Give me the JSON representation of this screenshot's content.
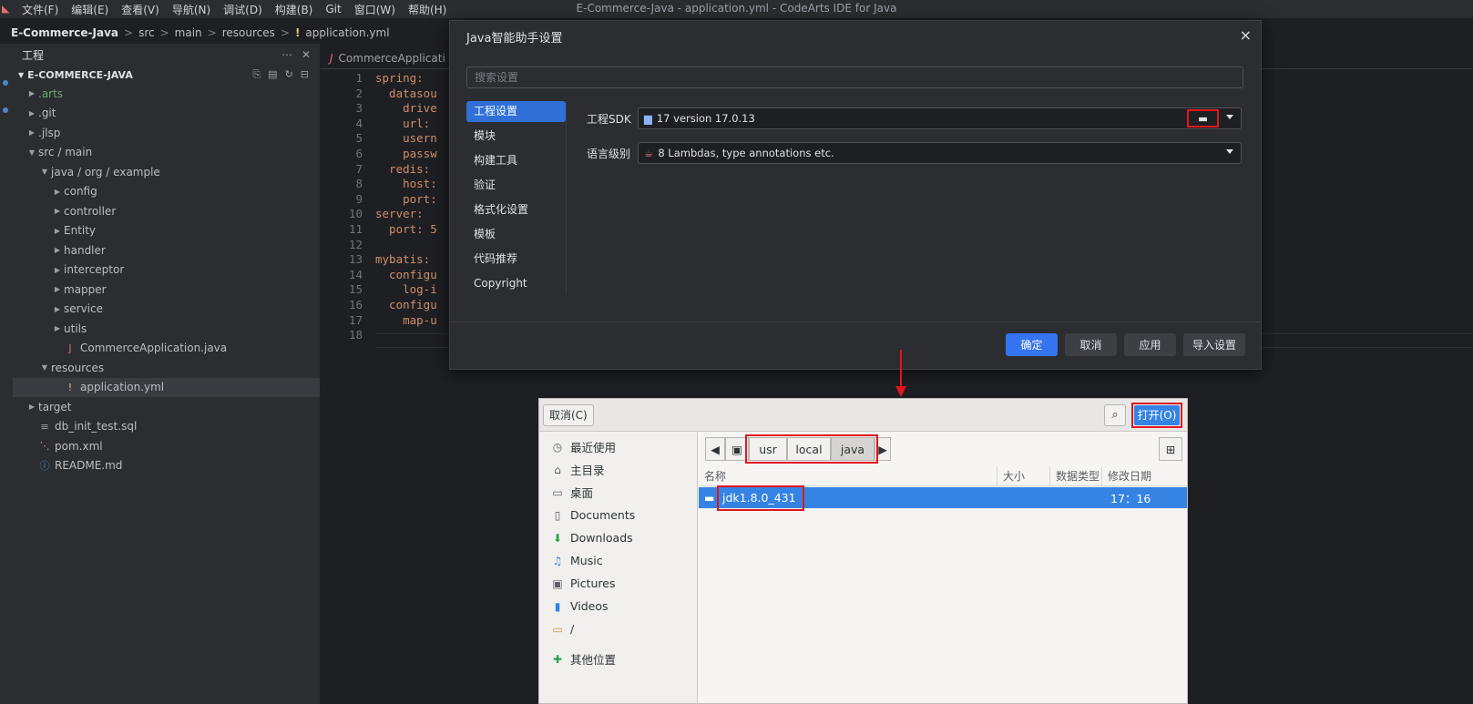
{
  "menubar": {
    "items": [
      "文件(F)",
      "编辑(E)",
      "查看(V)",
      "导航(N)",
      "调试(D)",
      "构建(B)",
      "Git",
      "窗口(W)",
      "帮助(H)"
    ],
    "window_title": "E-Commerce-Java - application.yml - CodeArts IDE for Java"
  },
  "breadcrumb": {
    "project": "E-Commerce-Java",
    "parts": [
      "src",
      "main",
      "resources",
      "application.yml"
    ]
  },
  "sidebar": {
    "title": "工程",
    "root": "E-COMMERCE-JAVA",
    "tree": [
      {
        "label": ".arts",
        "depth": 1,
        "type": "folder",
        "green": true
      },
      {
        "label": ".git",
        "depth": 1,
        "type": "folder"
      },
      {
        "label": ".jlsp",
        "depth": 1,
        "type": "folder"
      },
      {
        "label": "src / main",
        "depth": 1,
        "type": "folder-open"
      },
      {
        "label": "java / org / example",
        "depth": 2,
        "type": "folder-open"
      },
      {
        "label": "config",
        "depth": 3,
        "type": "folder"
      },
      {
        "label": "controller",
        "depth": 3,
        "type": "folder"
      },
      {
        "label": "Entity",
        "depth": 3,
        "type": "folder"
      },
      {
        "label": "handler",
        "depth": 3,
        "type": "folder"
      },
      {
        "label": "interceptor",
        "depth": 3,
        "type": "folder"
      },
      {
        "label": "mapper",
        "depth": 3,
        "type": "folder"
      },
      {
        "label": "service",
        "depth": 3,
        "type": "folder"
      },
      {
        "label": "utils",
        "depth": 3,
        "type": "folder"
      },
      {
        "label": "CommerceApplication.java",
        "depth": 3,
        "type": "java"
      },
      {
        "label": "resources",
        "depth": 2,
        "type": "folder-open"
      },
      {
        "label": "application.yml",
        "depth": 3,
        "type": "yml",
        "selected": true
      },
      {
        "label": "target",
        "depth": 1,
        "type": "folder"
      },
      {
        "label": "db_init_test.sql",
        "depth": 1,
        "type": "sql"
      },
      {
        "label": "pom.xml",
        "depth": 1,
        "type": "xml"
      },
      {
        "label": "README.md",
        "depth": 1,
        "type": "md"
      }
    ]
  },
  "editor": {
    "tab": "CommerceApplicati",
    "lines": [
      {
        "n": "1",
        "code": "spring:"
      },
      {
        "n": "2",
        "code": "  datasou"
      },
      {
        "n": "3",
        "code": "    drive"
      },
      {
        "n": "4",
        "code": "    url:"
      },
      {
        "n": "5",
        "code": "    usern"
      },
      {
        "n": "6",
        "code": "    passw"
      },
      {
        "n": "7",
        "code": "  redis:"
      },
      {
        "n": "8",
        "code": "    host:"
      },
      {
        "n": "9",
        "code": "    port:"
      },
      {
        "n": "10",
        "code": "server:"
      },
      {
        "n": "11",
        "code": "  port: 5"
      },
      {
        "n": "12",
        "code": ""
      },
      {
        "n": "13",
        "code": "mybatis:"
      },
      {
        "n": "14",
        "code": "  configu"
      },
      {
        "n": "15",
        "code": "    log-i"
      },
      {
        "n": "16",
        "code": "  configu"
      },
      {
        "n": "17",
        "code": "    map-u"
      },
      {
        "n": "18",
        "code": ""
      }
    ]
  },
  "settings_dialog": {
    "title": "Java智能助手设置",
    "search_placeholder": "搜索设置",
    "nav": [
      "工程设置",
      "模块",
      "构建工具",
      "验证",
      "格式化设置",
      "模板",
      "代码推荐",
      "Copyright"
    ],
    "sdk_label": "工程SDK",
    "sdk_value": "17 version 17.0.13",
    "lang_label": "语言级别",
    "lang_value": "8 Lambdas, type annotations etc.",
    "buttons": {
      "ok": "确定",
      "cancel": "取消",
      "apply": "应用",
      "import": "导入设置"
    }
  },
  "file_dialog": {
    "cancel": "取消(C)",
    "open": "打开(O)",
    "places": [
      {
        "label": "最近使用",
        "icon": "clock-icon"
      },
      {
        "label": "主目录",
        "icon": "home-icon"
      },
      {
        "label": "桌面",
        "icon": "desktop-icon"
      },
      {
        "label": "Documents",
        "icon": "document-icon"
      },
      {
        "label": "Downloads",
        "icon": "download-icon"
      },
      {
        "label": "Music",
        "icon": "music-icon"
      },
      {
        "label": "Pictures",
        "icon": "picture-icon"
      },
      {
        "label": "Videos",
        "icon": "video-icon"
      },
      {
        "label": "/",
        "icon": "folder-icon"
      },
      {
        "label": "其他位置",
        "icon": "plus-icon"
      }
    ],
    "path": [
      "usr",
      "local",
      "java"
    ],
    "columns": [
      "名称",
      "大小",
      "数据类型",
      "修改日期"
    ],
    "files": [
      {
        "name": "jdk1.8.0_431",
        "modified": "17：16"
      }
    ]
  }
}
